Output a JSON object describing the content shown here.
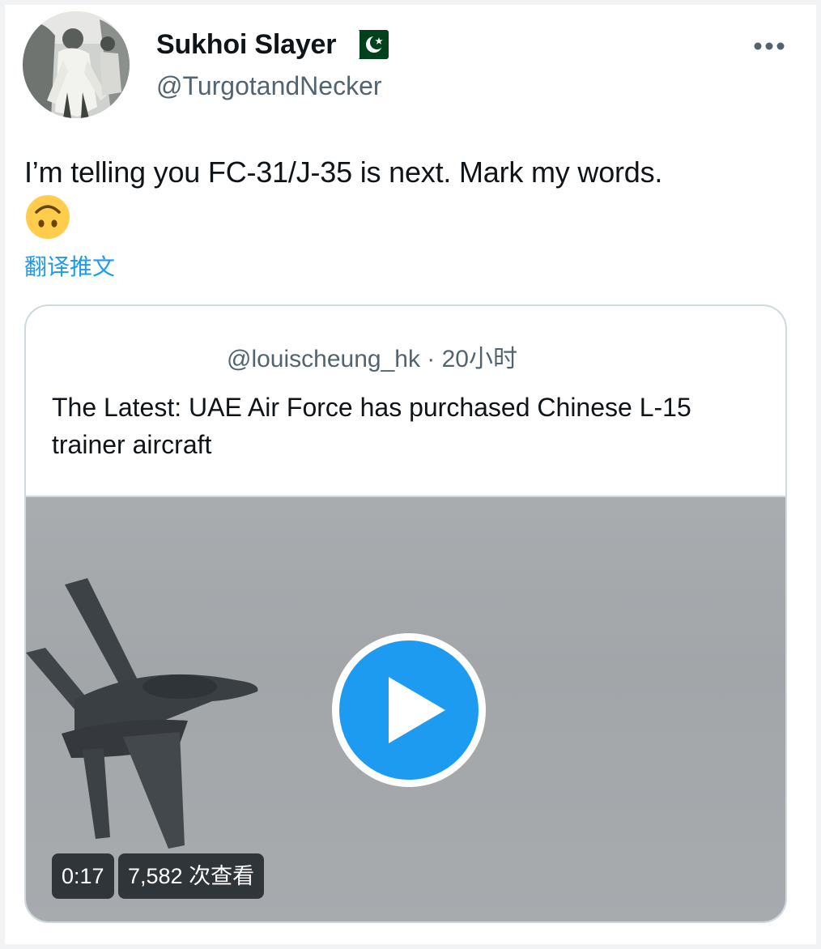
{
  "author": {
    "display_name": "Sukhoi Slayer",
    "handle": "@TurgotandNecker",
    "flag_icon": "pakistan-flag-icon",
    "avatar_icon": "profile-avatar"
  },
  "tweet": {
    "text": "I’m telling you FC-31/J-35 is next. Mark my words.",
    "emoji": "upside-down-face-emoji",
    "translate_label": "翻译推文"
  },
  "quote": {
    "meta": "@louischeung_hk · 20小时",
    "text": "The Latest: UAE Air Force has purchased Chinese L-15 trainer aircraft",
    "media": {
      "duration": "0:17",
      "views": "7,582 次查看",
      "play_icon": "play-icon"
    }
  },
  "colors": {
    "accent": "#1d9bf0",
    "text": "#0f1419",
    "secondary": "#536471",
    "border": "#cfd9de"
  }
}
